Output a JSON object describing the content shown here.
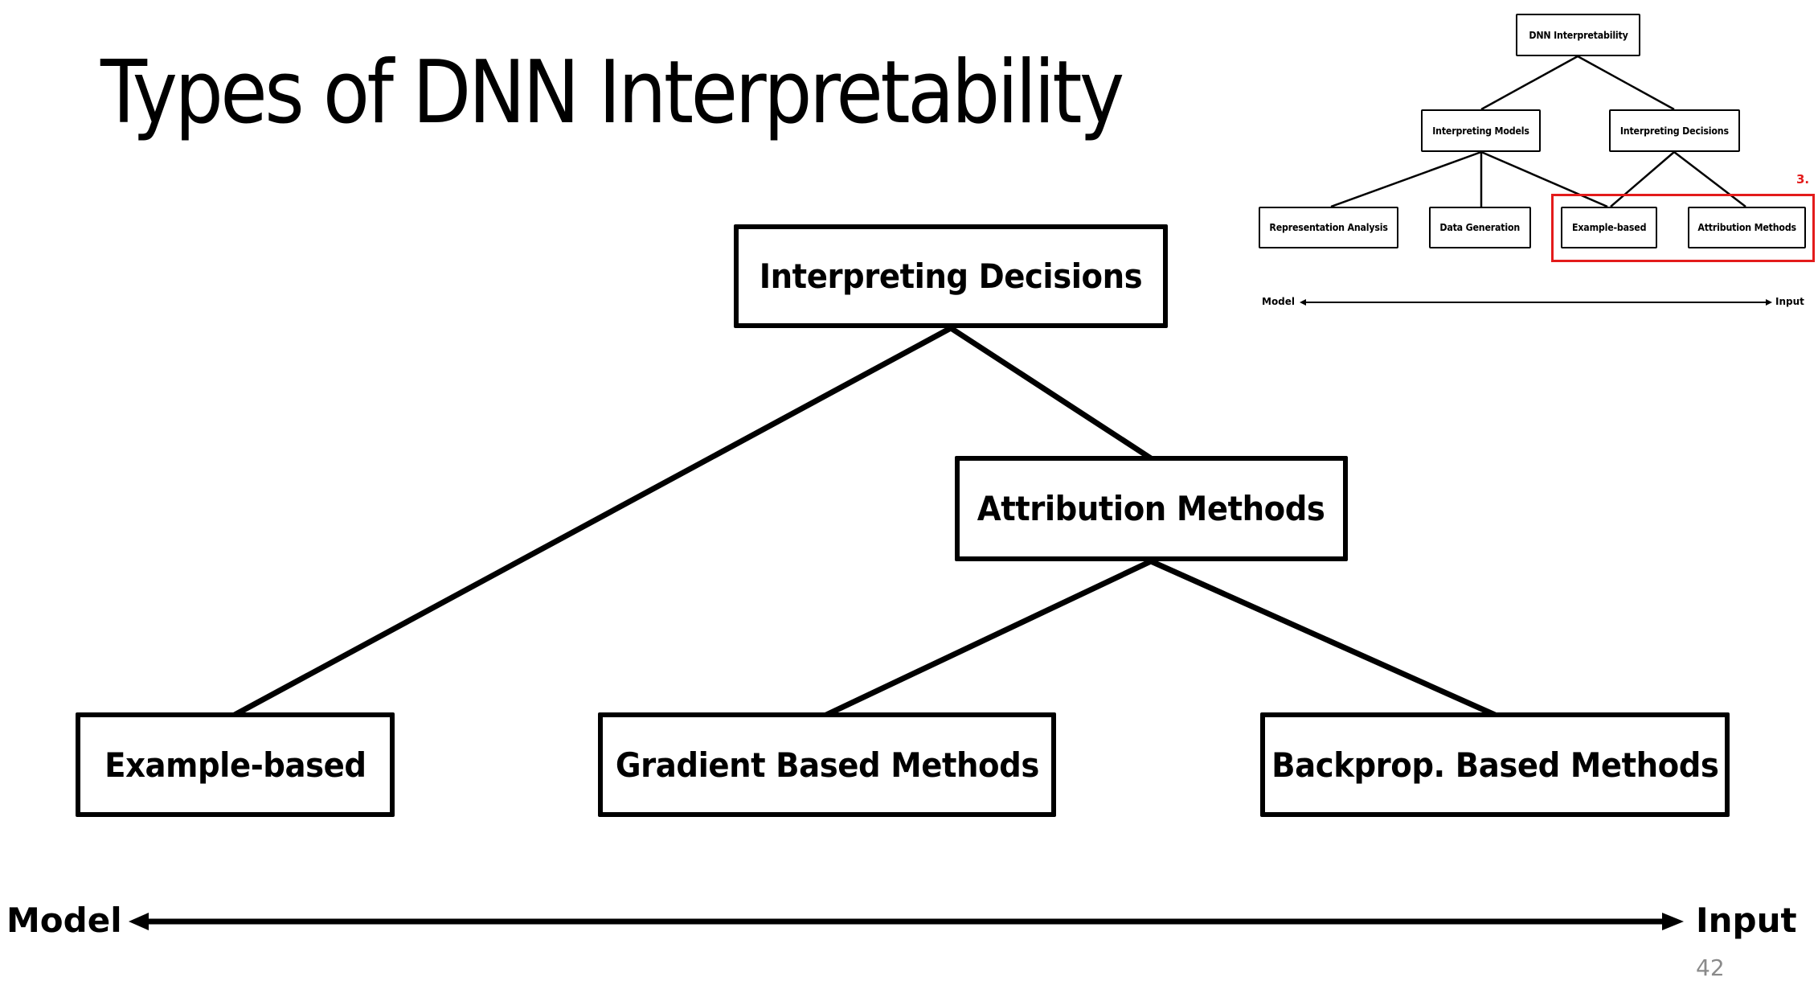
{
  "slide": {
    "title": "Types of DNN Interpretability",
    "page_number": "42"
  },
  "main_diagram": {
    "nodes": {
      "interpreting_decisions": "Interpreting Decisions",
      "attribution_methods": "Attribution Methods",
      "example_based": "Example-based",
      "gradient_based": "Gradient Based Methods",
      "backprop_based": "Backprop. Based Methods"
    },
    "edges": [
      [
        "interpreting_decisions",
        "example_based"
      ],
      [
        "interpreting_decisions",
        "attribution_methods"
      ],
      [
        "attribution_methods",
        "gradient_based"
      ],
      [
        "attribution_methods",
        "backprop_based"
      ]
    ],
    "axis": {
      "left_label": "Model",
      "right_label": "Input"
    }
  },
  "overview_thumbnail": {
    "nodes": {
      "root": "DNN Interpretability",
      "interpreting_models": "Interpreting Models",
      "interpreting_decisions": "Interpreting Decisions",
      "representation_analysis": "Representation Analysis",
      "data_generation": "Data Generation",
      "example_based": "Example-based",
      "attribution_methods": "Attribution Methods"
    },
    "edges": [
      [
        "root",
        "interpreting_models"
      ],
      [
        "root",
        "interpreting_decisions"
      ],
      [
        "interpreting_models",
        "representation_analysis"
      ],
      [
        "interpreting_models",
        "data_generation"
      ],
      [
        "interpreting_models",
        "example_based"
      ],
      [
        "interpreting_decisions",
        "example_based"
      ],
      [
        "interpreting_decisions",
        "attribution_methods"
      ]
    ],
    "highlight": {
      "label": "3.",
      "color": "#e31b1b",
      "covers": [
        "example_based",
        "attribution_methods"
      ]
    },
    "axis": {
      "left_label": "Model",
      "right_label": "Input"
    }
  }
}
